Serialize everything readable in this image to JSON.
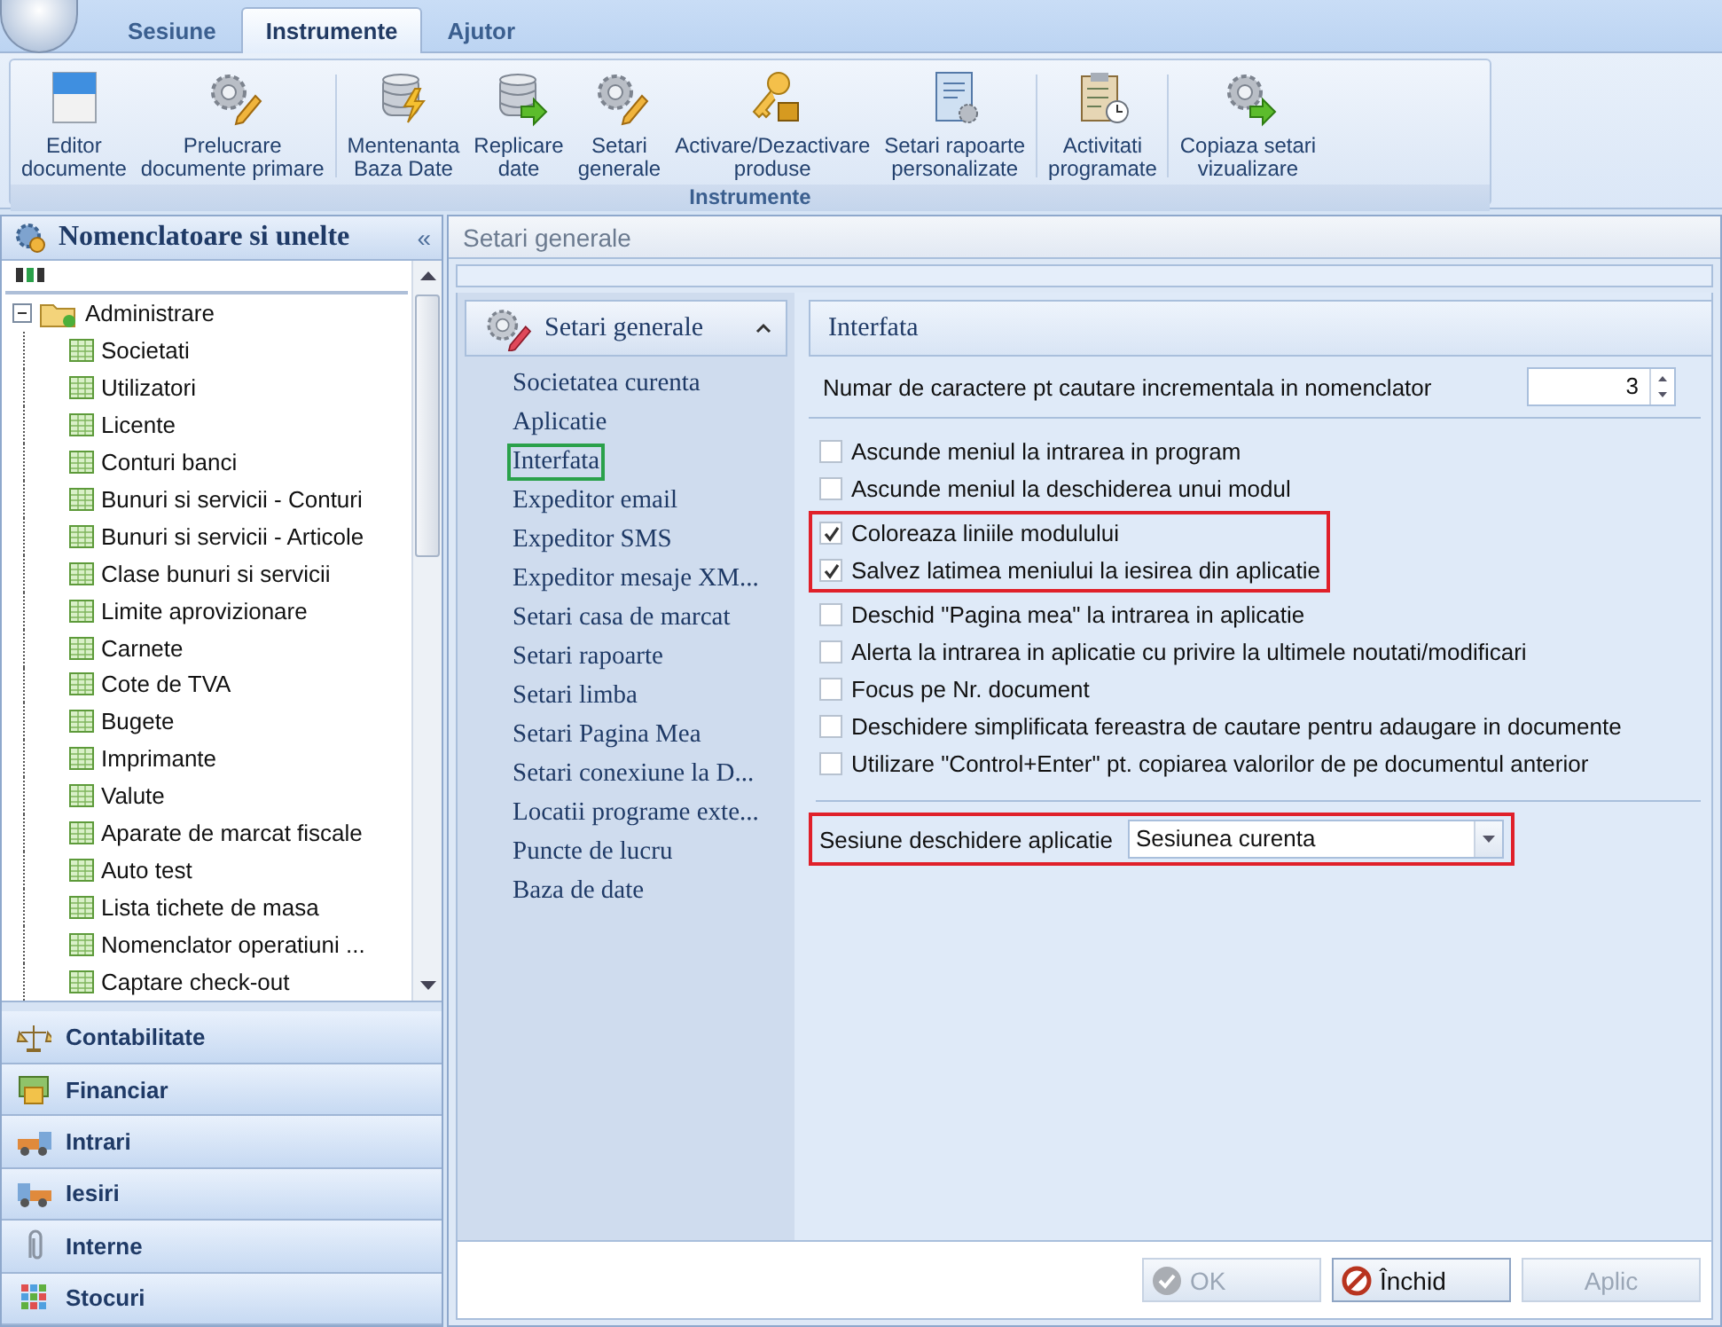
{
  "app_tabs": [
    {
      "label": "Sesiune",
      "selected": false
    },
    {
      "label": "Instrumente",
      "selected": true
    },
    {
      "label": "Ajutor",
      "selected": false
    }
  ],
  "ribbon": {
    "caption": "Instrumente",
    "groups": [
      {
        "items": [
          {
            "kind": "doc",
            "label": "Editor\ndocumente"
          },
          {
            "kind": "gear-pencil",
            "label": "Prelucrare\ndocumente primare"
          }
        ]
      },
      {
        "items": [
          {
            "kind": "db-bolt",
            "label": "Mentenanta\nBaza Date"
          },
          {
            "kind": "db-arrow",
            "label": "Replicare\ndate"
          },
          {
            "kind": "gear-pencil",
            "label": "Setari\ngenerale"
          },
          {
            "kind": "key-lock",
            "label": "Activare/Dezactivare\nproduse"
          },
          {
            "kind": "notebook",
            "label": "Setari rapoarte\npersonalizate"
          }
        ]
      },
      {
        "items": [
          {
            "kind": "clipboard-clock",
            "label": "Activitati\nprogramate"
          }
        ]
      },
      {
        "items": [
          {
            "kind": "gear-arrow",
            "label": "Copiaza setari\nvizualizare"
          }
        ]
      }
    ]
  },
  "sidebar": {
    "title": "Nomenclatoare si unelte",
    "collapse": "«",
    "tree": [
      {
        "label": "Administrare",
        "expanded": true,
        "children": [
          {
            "label": "Societati"
          },
          {
            "label": "Utilizatori"
          },
          {
            "label": "Licente"
          },
          {
            "label": "Conturi banci"
          },
          {
            "label": "Bunuri si servicii - Conturi"
          },
          {
            "label": "Bunuri si servicii - Articole"
          },
          {
            "label": "Clase bunuri si servicii"
          },
          {
            "label": "Limite aprovizionare"
          },
          {
            "label": "Carnete"
          },
          {
            "label": "Cote de TVA"
          },
          {
            "label": "Bugete"
          },
          {
            "label": "Imprimante"
          },
          {
            "label": "Valute"
          },
          {
            "label": "Aparate de marcat fiscale"
          },
          {
            "label": "Auto test"
          },
          {
            "label": "Lista tichete de masa"
          },
          {
            "label": "Nomenclator operatiuni ..."
          },
          {
            "label": "Captare check-out"
          }
        ]
      }
    ],
    "modules": [
      {
        "kind": "scales",
        "label": "Contabilitate"
      },
      {
        "kind": "money",
        "label": "Financiar"
      },
      {
        "kind": "truck-in",
        "label": "Intrari"
      },
      {
        "kind": "truck-out",
        "label": "Iesiri"
      },
      {
        "kind": "clip",
        "label": "Interne"
      },
      {
        "kind": "grid",
        "label": "Stocuri"
      }
    ]
  },
  "dialog": {
    "title": "Setari generale",
    "nav_header": "Setari generale",
    "nav": [
      {
        "label": "Societatea curenta",
        "selected": false
      },
      {
        "label": "Aplicatie",
        "selected": false
      },
      {
        "label": "Interfata",
        "selected": true
      },
      {
        "label": "Expeditor email",
        "selected": false
      },
      {
        "label": "Expeditor SMS",
        "selected": false
      },
      {
        "label": "Expeditor mesaje XM...",
        "selected": false
      },
      {
        "label": "Setari casa de marcat",
        "selected": false
      },
      {
        "label": "Setari rapoarte",
        "selected": false
      },
      {
        "label": "Setari limba",
        "selected": false
      },
      {
        "label": "Setari Pagina Mea",
        "selected": false
      },
      {
        "label": "Setari conexiune la D...",
        "selected": false
      },
      {
        "label": "Locatii programe exte...",
        "selected": false
      },
      {
        "label": "Puncte de lucru",
        "selected": false
      },
      {
        "label": "Baza de date",
        "selected": false
      }
    ],
    "section": "Interfata",
    "number_field": {
      "label": "Numar de caractere pt cautare incrementala in nomenclator",
      "value": "3"
    },
    "option_groups": [
      {
        "highlighted": false,
        "options": [
          {
            "label": "Ascunde meniul la intrarea in program",
            "checked": false
          },
          {
            "label": "Ascunde meniul la deschiderea unui modul",
            "checked": false
          }
        ]
      },
      {
        "highlighted": true,
        "options": [
          {
            "label": "Coloreaza liniile modulului",
            "checked": true
          },
          {
            "label": "Salvez latimea meniului la iesirea din aplicatie",
            "checked": true
          }
        ]
      },
      {
        "highlighted": false,
        "options": [
          {
            "label": "Deschid \"Pagina mea\" la intrarea in aplicatie",
            "checked": false
          },
          {
            "label": "Alerta la intrarea in aplicatie cu privire la ultimele noutati/modificari",
            "checked": false
          },
          {
            "label": "Focus pe Nr. document",
            "checked": false
          },
          {
            "label": "Deschidere simplificata fereastra de cautare pentru adaugare in documente",
            "checked": false
          },
          {
            "label": "Utilizare \"Control+Enter\" pt. copiarea valorilor de pe documentul anterior",
            "checked": false
          }
        ]
      }
    ],
    "session": {
      "label": "Sesiune deschidere aplicatie",
      "value": "Sesiunea curenta",
      "highlighted": true
    },
    "buttons": [
      {
        "label": "OK",
        "kind": "confirm",
        "disabled": true
      },
      {
        "label": "Închid",
        "kind": "close",
        "disabled": false
      },
      {
        "label": "Aplic",
        "kind": "apply",
        "disabled": true
      }
    ]
  }
}
